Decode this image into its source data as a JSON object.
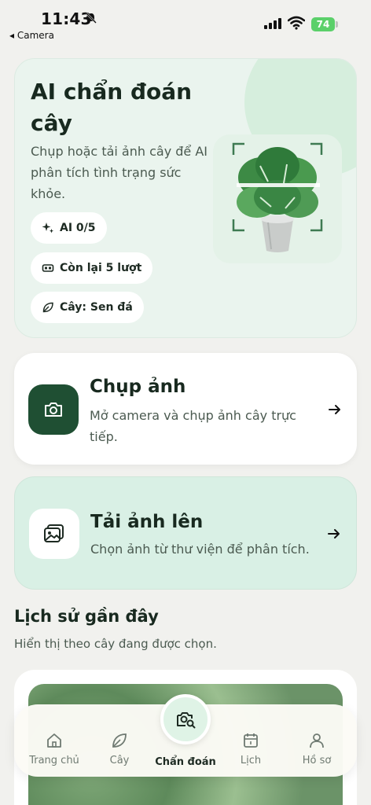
{
  "status_bar": {
    "time": "11:43",
    "back_app": "◂ Camera",
    "battery": "74"
  },
  "hero": {
    "title": "AI chẩn đoán cây",
    "description": "Chụp hoặc tải ảnh cây để AI phân tích tình trạng sức khỏe.",
    "chips": [
      "AI 0/5",
      "Còn lại 5 lượt",
      "Cây: Sen đá"
    ]
  },
  "actions": {
    "camera": {
      "title": "Chụp ảnh",
      "subtitle": "Mở camera và chụp ảnh cây trực tiếp."
    },
    "upload": {
      "title": "Tải ảnh lên",
      "subtitle": "Chọn ảnh từ thư viện để phân tích."
    }
  },
  "history": {
    "title": "Lịch sử gần đây",
    "subtitle": "Hiển thị theo cây đang được chọn."
  },
  "nav": {
    "items": [
      "Trang chủ",
      "Cây",
      "Chẩn đoán",
      "Lịch",
      "Hồ sơ"
    ],
    "active": "Chẩn đoán"
  },
  "colors": {
    "accent_dark": "#1f4f33",
    "mint": "#d9f0e5",
    "battery": "#5bd06a"
  }
}
